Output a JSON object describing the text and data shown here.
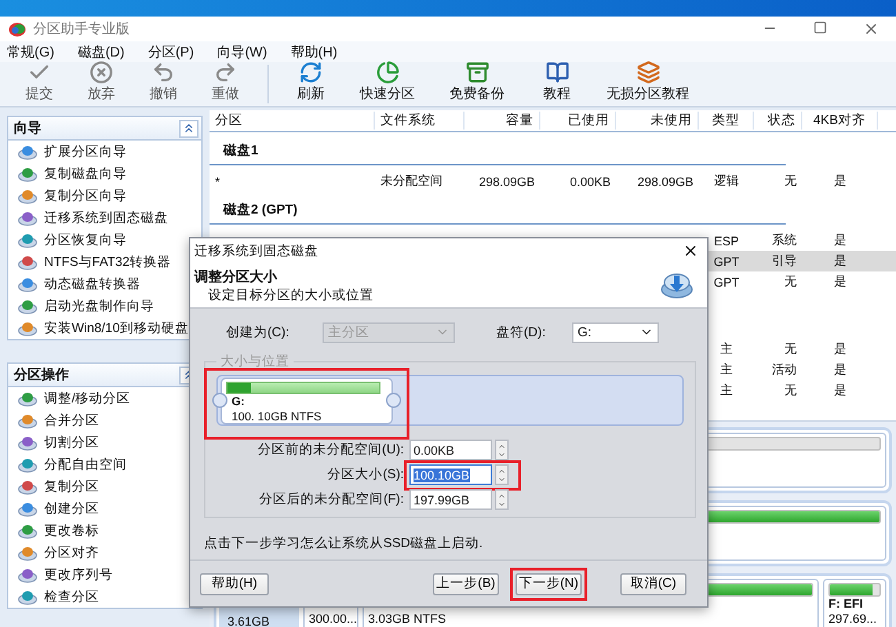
{
  "window": {
    "title": "分区助手专业版"
  },
  "menu": [
    "常规(G)",
    "磁盘(D)",
    "分区(P)",
    "向导(W)",
    "帮助(H)"
  ],
  "toolbar": [
    {
      "kind": "commit",
      "label": "提交",
      "disabled": true
    },
    {
      "kind": "discard",
      "label": "放弃",
      "disabled": true
    },
    {
      "kind": "undo",
      "label": "撤销",
      "disabled": true
    },
    {
      "kind": "redo",
      "label": "重做",
      "disabled": true
    },
    {
      "kind": "refresh",
      "label": "刷新",
      "disabled": false
    },
    {
      "kind": "quick",
      "label": "快速分区",
      "disabled": false
    },
    {
      "kind": "backup",
      "label": "免费备份",
      "disabled": false
    },
    {
      "kind": "tutorial",
      "label": "教程",
      "disabled": false
    },
    {
      "kind": "lossless",
      "label": "无损分区教程",
      "disabled": false
    }
  ],
  "sidebar": [
    {
      "title": "向导",
      "expanded": true,
      "items": [
        "扩展分区向导",
        "复制磁盘向导",
        "复制分区向导",
        "迁移系统到固态磁盘",
        "分区恢复向导",
        "NTFS与FAT32转换器",
        "动态磁盘转换器",
        "启动光盘制作向导",
        "安装Win8/10到移动硬盘"
      ]
    },
    {
      "title": "分区操作",
      "expanded": true,
      "items": [
        "调整/移动分区",
        "合并分区",
        "切割分区",
        "分配自由空间",
        "复制分区",
        "创建分区",
        "更改卷标",
        "分区对齐",
        "更改序列号",
        "检查分区"
      ]
    }
  ],
  "table": {
    "columns": [
      "分区",
      "文件系统",
      "容量",
      "已使用",
      "未使用",
      "类型",
      "状态",
      "4KB对齐"
    ],
    "groups": [
      {
        "title": "磁盘1",
        "rows": [
          {
            "partition": "*",
            "file_system": "未分配空间",
            "capacity": "298.09GB",
            "used": "0.00KB",
            "unused": "298.09GB",
            "type": "逻辑",
            "status": "无",
            "align": "是",
            "selected": false
          }
        ]
      },
      {
        "title": "磁盘2 (GPT)",
        "rows": [
          {
            "type": "ESP",
            "status": "系统",
            "align": "是",
            "selected": false
          },
          {
            "type": "GPT",
            "status": "引导",
            "align": "是",
            "selected": true
          },
          {
            "type": "GPT",
            "status": "无",
            "align": "是",
            "selected": false
          }
        ]
      },
      {
        "rows": [
          {
            "type": "主",
            "status": "无",
            "align": "是",
            "selected": false
          },
          {
            "type": "主",
            "status": "活动",
            "align": "是",
            "selected": false
          },
          {
            "type": "主",
            "status": "无",
            "align": "是",
            "selected": false
          }
        ]
      }
    ]
  },
  "disk_map": [
    {
      "partitions": [
        {
          "kind": "unallocated"
        }
      ]
    },
    {
      "partitions": [
        {
          "kind": "partition",
          "level": 1
        }
      ]
    },
    {
      "size": "3.61GB",
      "partitions": [
        {
          "kind": "partition",
          "label": "300.00..."
        },
        {
          "kind": "partition",
          "label": "3.03GB NTFS",
          "level": 1
        },
        {
          "kind": "partition",
          "name": "F: EFI",
          "label": "297.69...",
          "level": 0.85
        }
      ]
    }
  ],
  "dialog": {
    "title": "迁移系统到固态磁盘",
    "heading": "调整分区大小",
    "subheading": "设定目标分区的大小或位置",
    "create_as": {
      "label": "创建为(C):",
      "value": "主分区",
      "disabled": true
    },
    "drive_letter": {
      "label": "盘符(D):",
      "value": "G:",
      "disabled": false
    },
    "group_title": "大小与位置",
    "partition": {
      "name": "G:",
      "info": "100. 10GB NTFS",
      "level": 0.15
    },
    "fields": [
      {
        "label": "分区前的未分配空间(U):",
        "value": "0.00KB",
        "selected": false
      },
      {
        "label": "分区大小(S):",
        "value": "100.10GB",
        "selected": true
      },
      {
        "label": "分区后的未分配空间(F):",
        "value": "197.99GB",
        "selected": false
      }
    ],
    "hint": "点击下一步学习怎么让系统从SSD磁盘上启动.",
    "buttons": [
      {
        "kind": "help",
        "label": "帮助(H)",
        "highlighted": false
      },
      {
        "kind": "back",
        "label": "上一步(B)",
        "highlighted": false
      },
      {
        "kind": "next",
        "label": "下一步(N)",
        "highlighted": true
      },
      {
        "kind": "cancel",
        "label": "取消(C)",
        "highlighted": false
      }
    ]
  }
}
